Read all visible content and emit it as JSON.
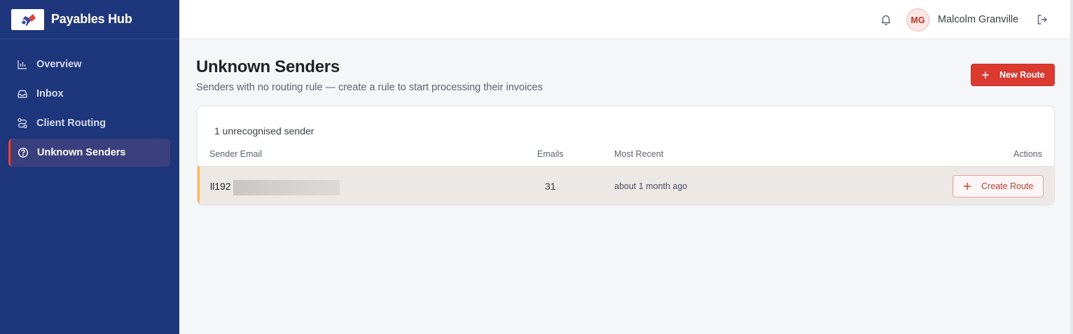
{
  "app": {
    "title": "Payables Hub"
  },
  "sidebar": {
    "items": [
      {
        "label": "Overview",
        "icon": "bar-chart-icon"
      },
      {
        "label": "Inbox",
        "icon": "inbox-icon"
      },
      {
        "label": "Client Routing",
        "icon": "routing-icon"
      },
      {
        "label": "Unknown Senders",
        "icon": "help-circle-icon",
        "active": true
      }
    ]
  },
  "header": {
    "user": {
      "initials": "MG",
      "name": "Malcolm Granville"
    }
  },
  "page": {
    "title": "Unknown Senders",
    "subtitle": "Senders with no routing rule — create a rule to start processing their invoices",
    "new_route_label": "New Route"
  },
  "table": {
    "count_label": "1 unrecognised sender",
    "columns": [
      "Sender Email",
      "Emails",
      "Most Recent",
      "Actions"
    ],
    "rows": [
      {
        "sender_email": "ll192",
        "emails": "31",
        "most_recent": "about 1 month ago",
        "action_label": "Create Route"
      }
    ]
  },
  "colors": {
    "sidebar_bg": "#1e367c",
    "accent": "#dc3a2e",
    "row_highlight": "#ece8e6",
    "row_marker": "#f2b866"
  }
}
